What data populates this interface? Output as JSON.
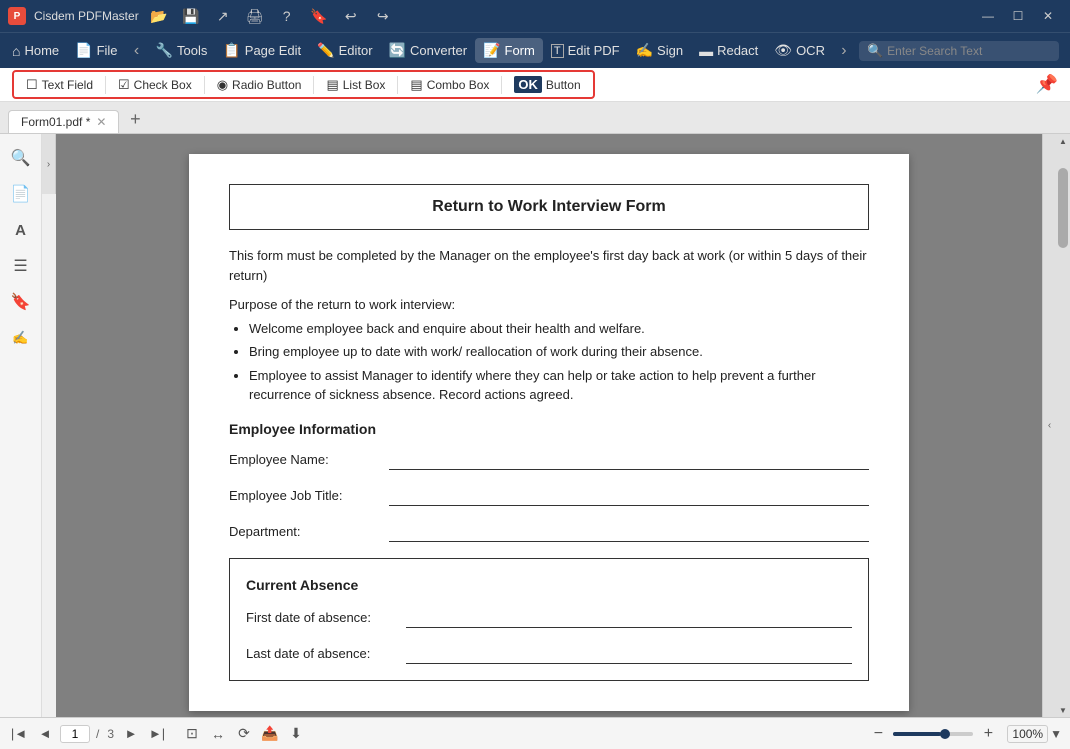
{
  "titleBar": {
    "appName": "Cisdem PDFMaster",
    "appIconLetter": "P"
  },
  "menuBar": {
    "items": [
      {
        "id": "home",
        "label": "Home",
        "icon": "⌂"
      },
      {
        "id": "file",
        "label": "File",
        "icon": "📄"
      },
      {
        "id": "tools",
        "label": "Tools",
        "icon": "🔧"
      },
      {
        "id": "page-edit",
        "label": "Page Edit",
        "icon": "📋"
      },
      {
        "id": "editor",
        "label": "Editor",
        "icon": "✏️"
      },
      {
        "id": "converter",
        "label": "Converter",
        "icon": "🔄"
      },
      {
        "id": "form",
        "label": "Form",
        "icon": "📝",
        "active": true
      },
      {
        "id": "edit-pdf",
        "label": "Edit PDF",
        "icon": "T"
      },
      {
        "id": "sign",
        "label": "Sign",
        "icon": "✍"
      },
      {
        "id": "redact",
        "label": "Redact",
        "icon": "🔒"
      },
      {
        "id": "ocr",
        "label": "OCR",
        "icon": "👁"
      }
    ],
    "searchPlaceholder": "Enter Search Text"
  },
  "formToolbar": {
    "tools": [
      {
        "id": "text-field",
        "label": "Text Field",
        "icon": "☐"
      },
      {
        "id": "check-box",
        "label": "Check Box",
        "icon": "☑"
      },
      {
        "id": "radio-button",
        "label": "Radio Button",
        "icon": "◉"
      },
      {
        "id": "list-box",
        "label": "List Box",
        "icon": "▤"
      },
      {
        "id": "combo-box",
        "label": "Combo Box",
        "icon": "▤"
      },
      {
        "id": "button",
        "label": "Button",
        "icon": "OK"
      }
    ]
  },
  "tabs": [
    {
      "id": "tab1",
      "label": "Form01.pdf *",
      "active": true
    }
  ],
  "sidebar": {
    "icons": [
      {
        "id": "search",
        "icon": "🔍"
      },
      {
        "id": "pages",
        "icon": "📄"
      },
      {
        "id": "text",
        "icon": "A"
      },
      {
        "id": "list",
        "icon": "☰"
      },
      {
        "id": "bookmark",
        "icon": "🔖"
      },
      {
        "id": "signature",
        "icon": "✍"
      }
    ]
  },
  "document": {
    "title": "Return to Work Interview Form",
    "intro1": "This form must be completed by the Manager on the employee's first day back at work (or within 5 days of their return)",
    "purposeHeading": "Purpose of the return to work interview:",
    "bullets": [
      "Welcome employee back and enquire about their health and welfare.",
      "Bring employee up to date with work/ reallocation of work during their absence.",
      "Employee to assist Manager to identify where they can help or take action to help prevent a further recurrence of sickness absence. Record actions agreed."
    ],
    "employeeInfoHeader": "Employee Information",
    "fields": [
      {
        "label": "Employee Name:"
      },
      {
        "label": "Employee Job Title:"
      },
      {
        "label": "Department:"
      }
    ],
    "currentAbsenceHeader": "Current Absence",
    "absenceFields": [
      {
        "label": "First date of absence:"
      },
      {
        "label": "Last date of absence:"
      }
    ]
  },
  "bottomBar": {
    "currentPage": "1",
    "totalPages": "3",
    "zoomLevel": "100%"
  }
}
